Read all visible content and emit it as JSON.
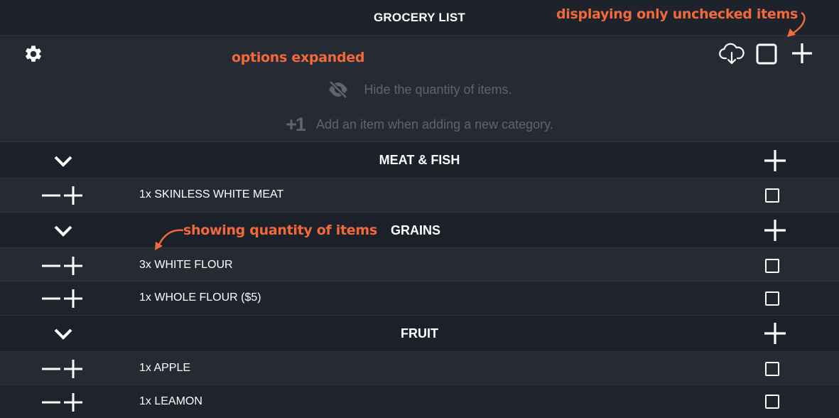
{
  "header": {
    "title": "GROCERY LIST"
  },
  "toolbar": {
    "settings_icon": "gear-icon",
    "download_icon": "cloud-download-icon",
    "filter_icon": "checkbox-icon",
    "add_icon": "plus-icon"
  },
  "options": {
    "hide_quantity": {
      "icon": "eye-slash-icon",
      "label": "Hide the quantity of items."
    },
    "add_item_on_category": {
      "icon_text": "+1",
      "label": "Add an item when adding a new category."
    }
  },
  "categories": [
    {
      "title": "MEAT & FISH",
      "items": [
        {
          "label": "1x SKINLESS WHITE MEAT"
        }
      ]
    },
    {
      "title": "GRAINS",
      "items": [
        {
          "label": "3x WHITE FLOUR"
        },
        {
          "label": "1x WHOLE FLOUR ($5)"
        }
      ]
    },
    {
      "title": "FRUIT",
      "items": [
        {
          "label": "1x APPLE"
        },
        {
          "label": "1x LEAMON"
        }
      ]
    }
  ],
  "annotations": {
    "unchecked": "displaying only unchecked items",
    "options": "options expanded",
    "quantity": "showing quantity of items"
  },
  "colors": {
    "background": "#1c2028",
    "panel": "#252a33",
    "annotation": "#f26a3c",
    "muted_text": "#5e6470",
    "text": "#ffffff"
  }
}
